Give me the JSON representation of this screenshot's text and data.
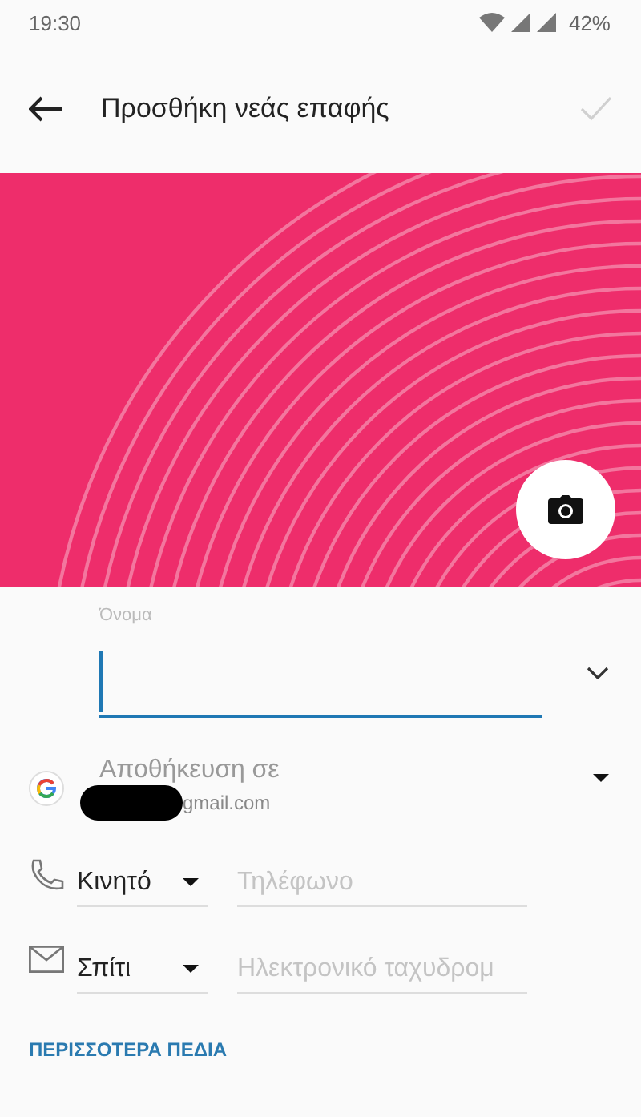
{
  "status_bar": {
    "time": "19:30",
    "battery": "42%"
  },
  "toolbar": {
    "title": "Προσθήκη νεάς επαφής",
    "save_disabled": true
  },
  "name_field": {
    "label": "Όνομα",
    "focused": true
  },
  "account": {
    "label": "Αποθήκευση σε",
    "email": "gmail.com"
  },
  "fields": [
    {
      "kind": "phone",
      "type": "Κινητό",
      "placeholder": "Τηλέφωνο"
    },
    {
      "kind": "email",
      "type": "Σπίτι",
      "placeholder": "Ηλεκτρονικό ταχυδρομ"
    }
  ],
  "more_button": "ΠΕΡΙΣΣΟΤΕΡΑ ΠΕΔΙΑ"
}
